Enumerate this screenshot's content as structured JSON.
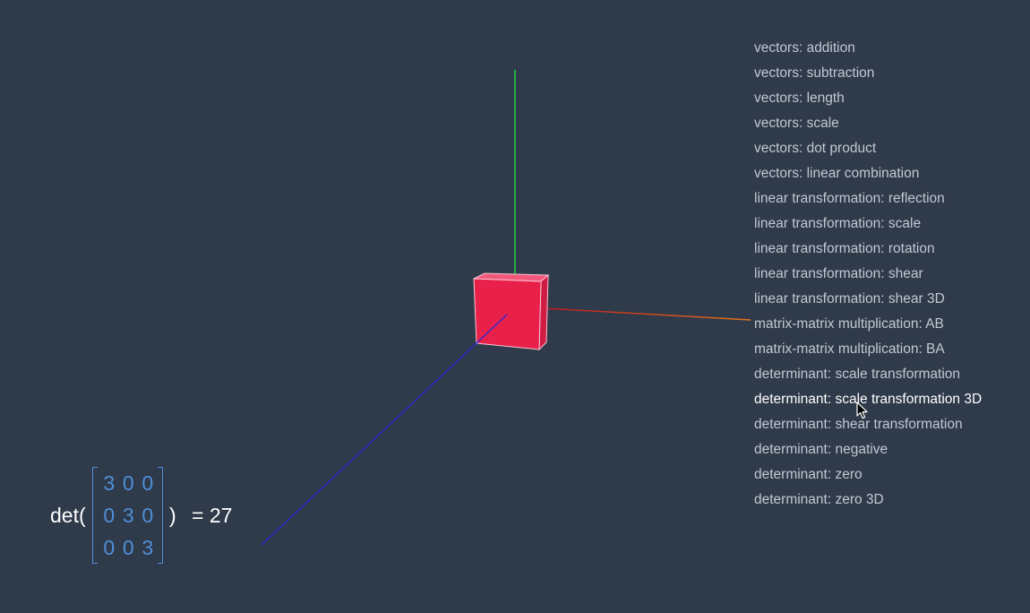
{
  "menu": {
    "items": [
      "vectors: addition",
      "vectors: subtraction",
      "vectors: length",
      "vectors: scale",
      "vectors: dot product",
      "vectors: linear combination",
      "linear transformation: reflection",
      "linear transformation: scale",
      "linear transformation: rotation",
      "linear transformation: shear",
      "linear transformation: shear 3D",
      "matrix-matrix multiplication: AB",
      "matrix-matrix multiplication: BA",
      "determinant: scale transformation",
      "determinant: scale transformation 3D",
      "determinant: shear transformation",
      "determinant: negative",
      "determinant: zero",
      "determinant: zero 3D"
    ],
    "active_index": 14
  },
  "formula": {
    "prefix": "det(",
    "matrix": [
      [
        "3",
        "0",
        "0"
      ],
      [
        "0",
        "3",
        "0"
      ],
      [
        "0",
        "0",
        "3"
      ]
    ],
    "close": ")",
    "result": "= 27"
  },
  "scene": {
    "axis_colors": {
      "x": "#e06010",
      "y": "#22cc44",
      "z": "#2a2ad8"
    },
    "cube_color": "#e8204a"
  },
  "colors": {
    "background": "#2f3a4b",
    "menu_text": "#c3c8d1",
    "menu_active": "#ffffff",
    "matrix": "#4f8fd8"
  }
}
